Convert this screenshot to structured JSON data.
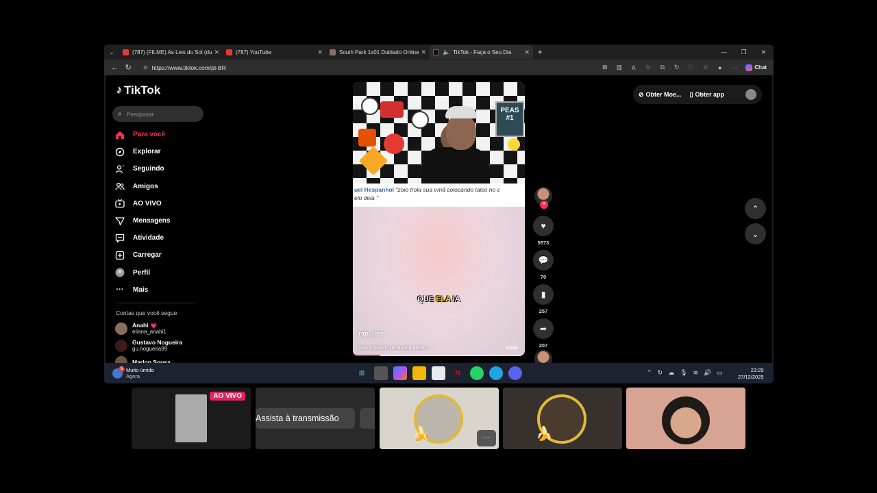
{
  "tabs": [
    {
      "title": "(787) (FILME) As Leis do Sol (dublado)",
      "fav_color": "#e53935"
    },
    {
      "title": "(787) YouTube",
      "fav_color": "#e53935"
    },
    {
      "title": "South Park 1x01 Dublado Online -",
      "fav_color": "#8d6e63"
    },
    {
      "title": "TikTok - Faça o Seu Dia",
      "fav_color": "#111111"
    }
  ],
  "address": {
    "url": "https://www.tiktok.com/pt-BR"
  },
  "browser": {
    "chat_label": "Chat"
  },
  "tiktok": {
    "logo": "TikTok",
    "search_placeholder": "Pesquisar",
    "nav": [
      {
        "label": "Para você",
        "icon": "home-icon",
        "active": true
      },
      {
        "label": "Explorar",
        "icon": "compass-icon"
      },
      {
        "label": "Seguindo",
        "icon": "following-icon"
      },
      {
        "label": "Amigos",
        "icon": "friends-icon"
      },
      {
        "label": "AO VIVO",
        "icon": "live-icon"
      },
      {
        "label": "Mensagens",
        "icon": "messages-icon"
      },
      {
        "label": "Atividade",
        "icon": "activity-icon"
      },
      {
        "label": "Carregar",
        "icon": "upload-icon"
      },
      {
        "label": "Perfil",
        "icon": "profile-icon"
      },
      {
        "label": "Mais",
        "icon": "more-icon"
      }
    ],
    "following_title": "Contas que você segue",
    "following": [
      {
        "name": "Anahi 💗",
        "user": "eliana_anahi1"
      },
      {
        "name": "Gustavo Nogueira",
        "user": "gu.nogueira99"
      },
      {
        "name": "Marlon Sousa",
        "user": ""
      }
    ],
    "top_right": {
      "coins": "Obter Moe...",
      "app": "Obter app"
    },
    "video": {
      "caption_author": "uel Hespanhol",
      "caption_text": "\"zoio trola sua irmã colocando talco no c",
      "caption_text2": "elo dela \"",
      "subtitle_a": "QUE ",
      "subtitle_b": "ELA",
      "subtitle_c": " IA",
      "author": "rap_ups",
      "description": "zoio trollando irmã dele parte 1 ...",
      "more": "mais",
      "progress": 0.16,
      "sign_text": "PEAS #1"
    },
    "actions": {
      "likes": "5573",
      "comments": "70",
      "saves": "257",
      "shares": "207"
    }
  },
  "taskbar": {
    "weather_title": "Muito úmido",
    "weather_sub": "Agora",
    "weather_badge": "5",
    "time": "23:29",
    "date": "27/12/2025"
  },
  "participants": {
    "live_badge": "AO VIVO",
    "watch_label": "Assista à transmissão",
    "more": "···"
  }
}
